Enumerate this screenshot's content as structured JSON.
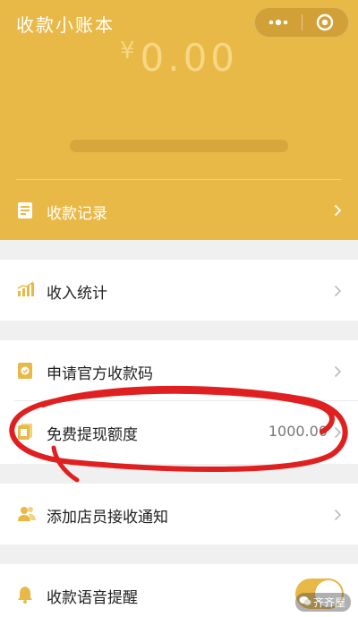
{
  "header": {
    "title": "收款小账本",
    "amount_symbol": "¥",
    "amount": "0.00",
    "records_label": "收款记录"
  },
  "rows": {
    "income_stats": "收入统计",
    "apply_code": "申请官方收款码",
    "free_withdraw": "免费提现额度",
    "free_withdraw_value": "1000.00",
    "add_clerk": "添加店员接收通知",
    "voice_reminder": "收款语音提醒"
  },
  "watermark": {
    "text": "齐齐屋"
  },
  "colors": {
    "brand": "#e9b948",
    "annotation": "#e02020"
  },
  "icons": {
    "records": "document-icon",
    "income_stats": "bar-chart-icon",
    "apply_code": "qr-code-card-icon",
    "free_withdraw": "cards-icon",
    "add_clerk": "people-icon",
    "voice_reminder": "bell-icon"
  },
  "toggles": {
    "voice_reminder_on": true
  }
}
